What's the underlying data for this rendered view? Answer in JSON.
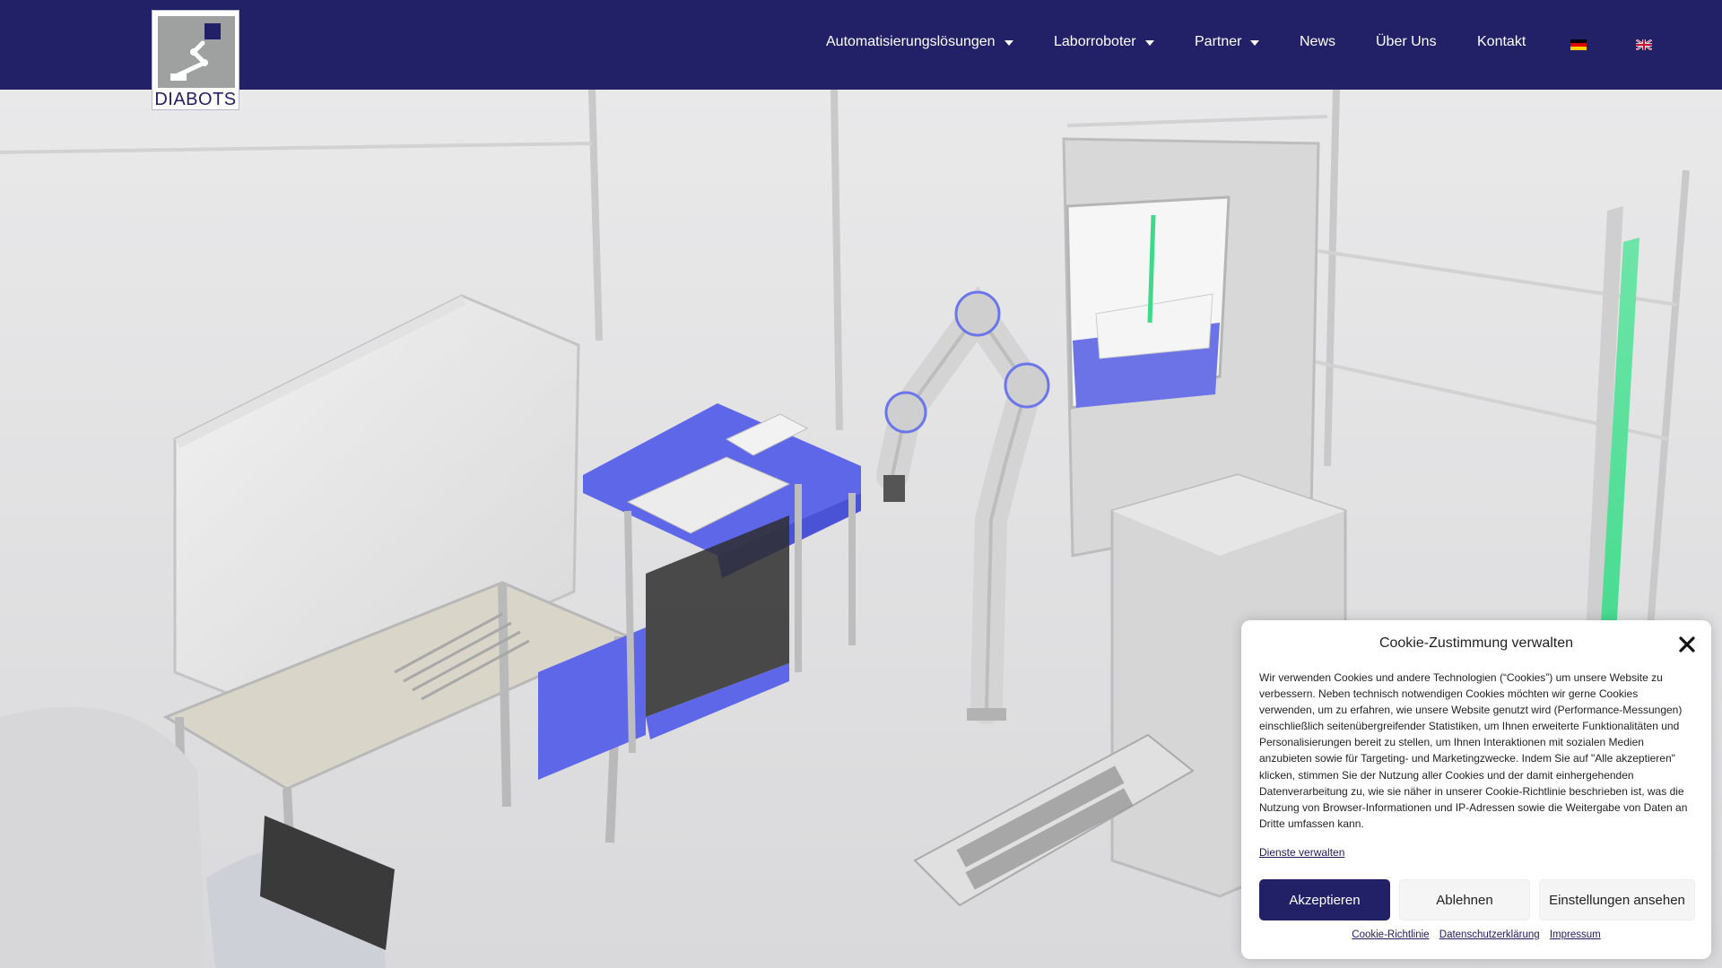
{
  "brand": {
    "logo_text": "DIABOTS",
    "accent": "#222066"
  },
  "nav": {
    "items": [
      {
        "label": "Automatisierungslösungen",
        "has_dropdown": true
      },
      {
        "label": "Laborroboter",
        "has_dropdown": true
      },
      {
        "label": "Partner",
        "has_dropdown": true
      },
      {
        "label": "News",
        "has_dropdown": false
      },
      {
        "label": "Über Uns",
        "has_dropdown": false
      },
      {
        "label": "Kontakt",
        "has_dropdown": false
      }
    ],
    "languages": [
      "de-flag-icon",
      "en-flag-icon"
    ]
  },
  "hero": {
    "image": "laboratory-automation-cell-render"
  },
  "cookie": {
    "title": "Cookie-Zustimmung verwalten",
    "text": "Wir verwenden Cookies und andere Technologien (“Cookies”) um unsere Website zu verbessern. Neben technisch notwendigen Cookies möchten wir gerne Cookies verwenden, um zu erfahren, wie unsere Website genutzt wird (Performance-Messungen) einschließlich seitenübergreifender Statistiken, um Ihnen erweiterte Funktionalitäten und Personalisierungen bereit zu stellen, um Ihnen Interaktionen mit sozialen Medien anzubieten sowie für Targeting- und Marketingzwecke. Indem Sie auf \"Alle akzeptieren\" klicken, stimmen Sie der Nutzung aller Cookies und der damit einhergehenden Datenverarbeitung zu, wie sie näher in unserer Cookie-Richtlinie beschrieben ist, was die Nutzung von Browser-Informationen und IP-Adressen sowie die Weitergabe von Daten an Dritte umfassen kann.",
    "manage_link": "Dienste verwalten",
    "accept_label": "Akzeptieren",
    "deny_label": "Ablehnen",
    "settings_label": "Einstellungen ansehen",
    "links": [
      "Cookie-Richtlinie",
      "Datenschutzerklärung",
      "Impressum"
    ]
  }
}
